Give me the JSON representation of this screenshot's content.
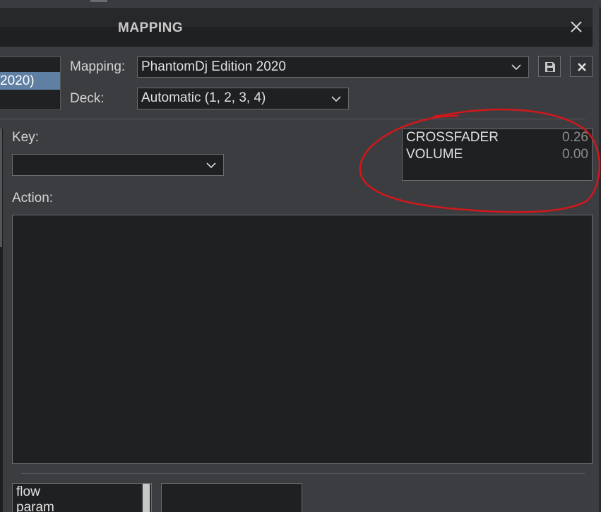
{
  "window": {
    "title": "MAPPING",
    "close_icon": "close-icon"
  },
  "left_list": {
    "selected_item": "2020)"
  },
  "mapping": {
    "label": "Mapping:",
    "value": "PhantomDj Edition 2020",
    "save_icon": "floppy-disk-icon",
    "delete_icon": "close-icon"
  },
  "deck": {
    "label": "Deck:",
    "value": "Automatic (1, 2, 3, 4)"
  },
  "key": {
    "label": "Key:",
    "value": ""
  },
  "readout": {
    "rows": [
      {
        "name": "CROSSFADER",
        "value": "0.26"
      },
      {
        "name": "VOLUME",
        "value": "0.00"
      }
    ]
  },
  "action": {
    "label": "Action:",
    "value": ""
  },
  "bottom_list": {
    "items": [
      "flow",
      "param"
    ]
  },
  "colors": {
    "background": "#3c3d40",
    "titlebar": "#1f2022",
    "field": "#1f2022",
    "selection": "#5f7fa3",
    "annotation": "#d0181c"
  }
}
